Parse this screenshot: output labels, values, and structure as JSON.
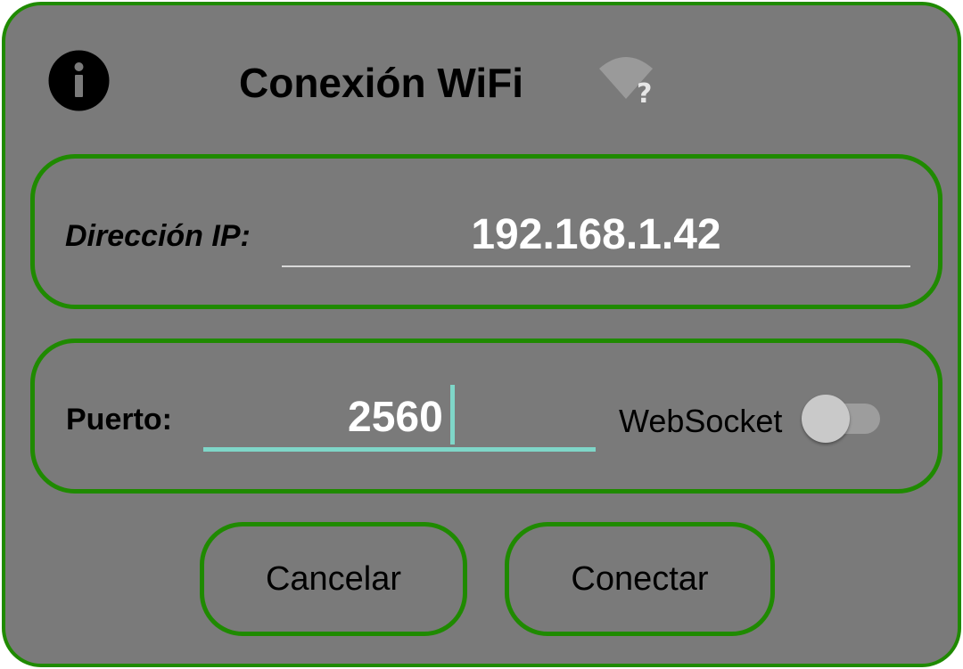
{
  "dialog": {
    "title": "Conexión WiFi",
    "info_icon": "info-icon",
    "wifi_icon": "wifi-unknown-icon"
  },
  "ip": {
    "label": "Dirección IP:",
    "value": "192.168.1.42"
  },
  "port": {
    "label": "Puerto:",
    "value": "2560"
  },
  "websocket": {
    "label": "WebSocket",
    "enabled": false
  },
  "buttons": {
    "cancel": "Cancelar",
    "connect": "Conectar"
  },
  "colors": {
    "background": "#7a7a7a",
    "border": "#1f8a00",
    "focus_accent": "#7fd6c8",
    "value_text": "#ffffff",
    "label_text": "#000000"
  }
}
